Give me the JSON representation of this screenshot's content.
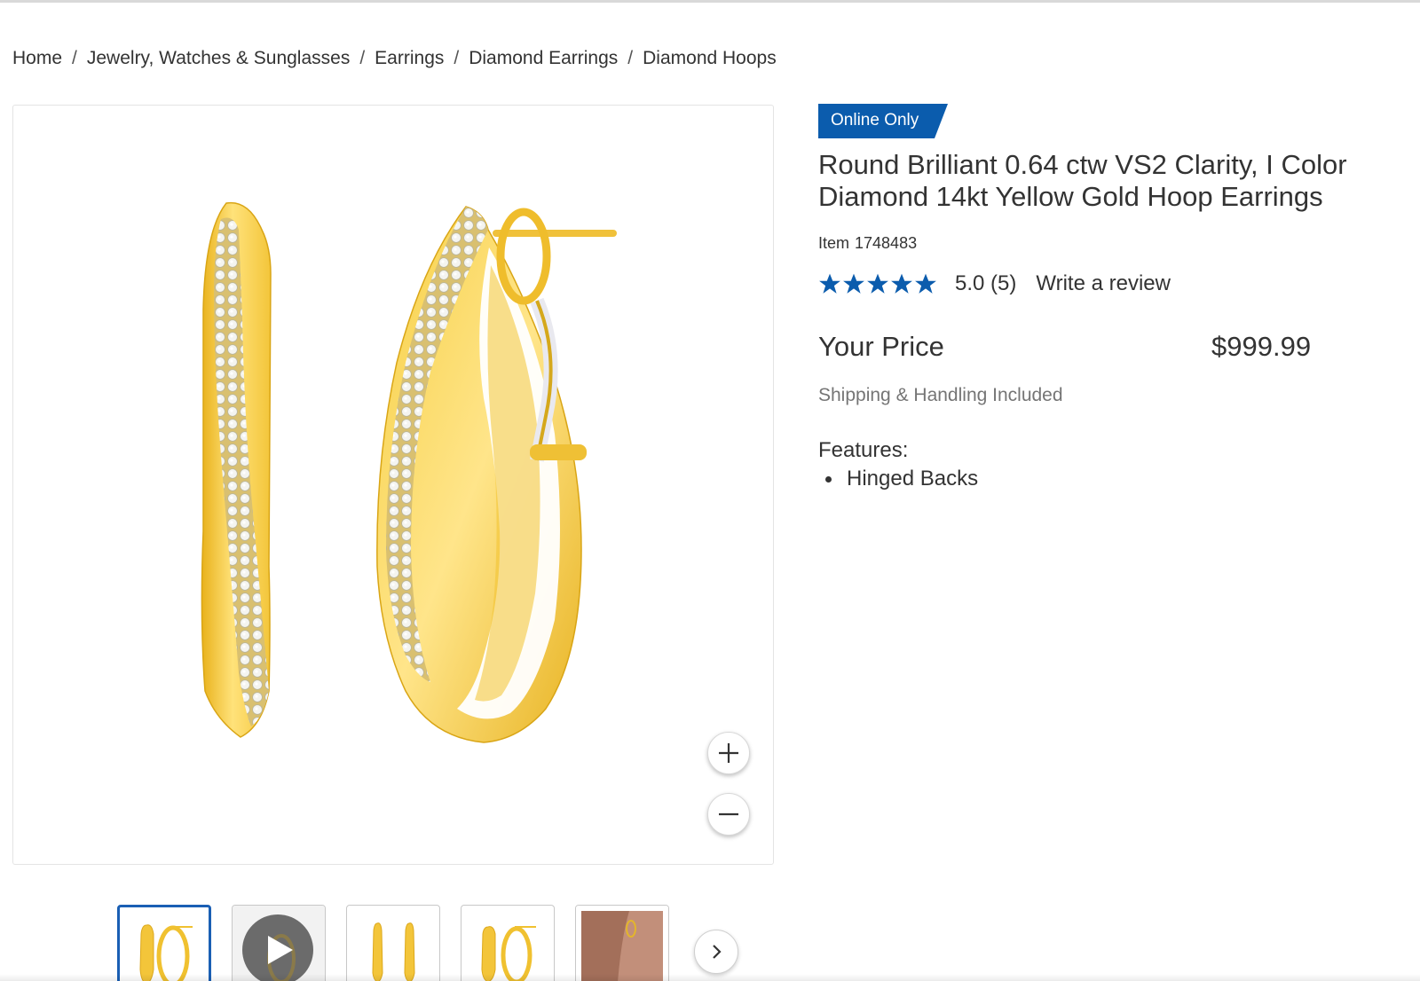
{
  "breadcrumb": [
    "Home",
    "Jewelry, Watches & Sunglasses",
    "Earrings",
    "Diamond Earrings",
    "Diamond Hoops"
  ],
  "badge": {
    "label": "Online Only",
    "color": "#0b5cad"
  },
  "product": {
    "title": "Round Brilliant 0.64 ctw VS2 Clarity, I Color Diamond 14kt Yellow Gold Hoop Earrings",
    "item_label": "Item",
    "item_number": "1748483",
    "rating": {
      "stars": 5,
      "star_color": "#0b5cad",
      "text": "5.0 (5)",
      "review_link": "Write a review"
    },
    "price_label": "Your Price",
    "price": "$999.99",
    "shipping_note": "Shipping & Handling Included",
    "features_label": "Features:",
    "features": [
      "Hinged Backs"
    ]
  },
  "gallery": {
    "zoom_in_icon": "plus-icon",
    "zoom_out_icon": "minus-icon",
    "next_icon": "chevron-right-icon",
    "thumbnails": [
      {
        "type": "image",
        "selected": true
      },
      {
        "type": "video",
        "selected": false
      },
      {
        "type": "image",
        "selected": false
      },
      {
        "type": "image",
        "selected": false
      },
      {
        "type": "image",
        "selected": false
      }
    ]
  }
}
